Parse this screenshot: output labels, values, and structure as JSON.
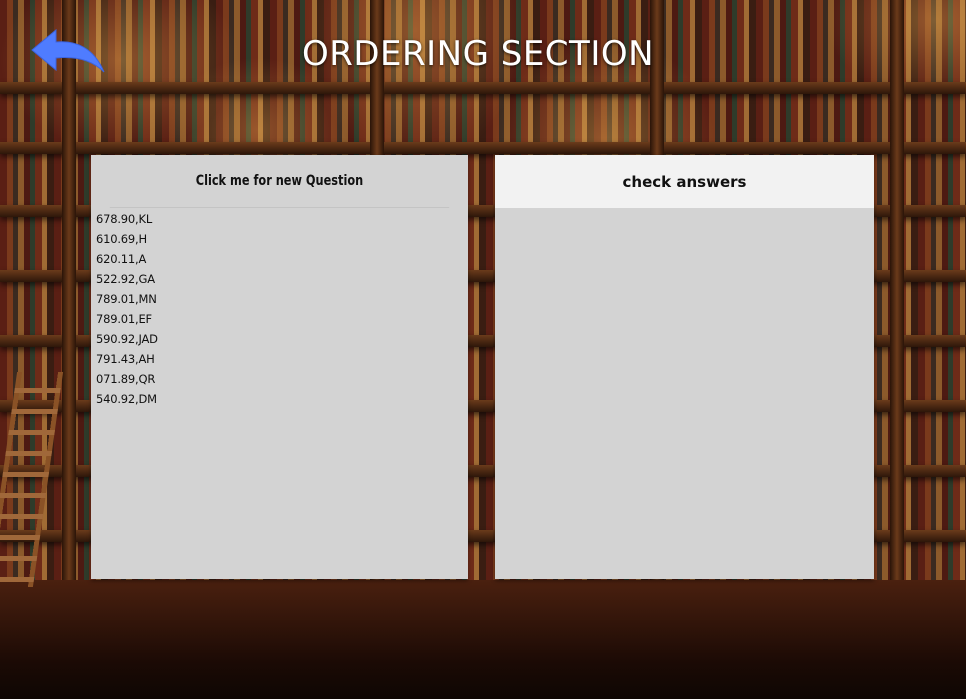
{
  "header": {
    "title": "ORDERING SECTION",
    "back_icon": "back-arrow-icon",
    "back_icon_color": "#4f7cff"
  },
  "left_panel": {
    "button_label": "Click me for new Question",
    "items": [
      "678.90,KL",
      "610.69,H",
      "620.11,A",
      "522.92,GA",
      "789.01,MN",
      "789.01,EF",
      "590.92,JAD",
      "791.43,AH",
      "071.89,QR",
      "540.92,DM"
    ]
  },
  "right_panel": {
    "button_label": "check answers"
  },
  "colors": {
    "panel_bg": "#d3d3d3",
    "check_button_bg": "#f2f2f2",
    "title_color": "#ffffff"
  }
}
